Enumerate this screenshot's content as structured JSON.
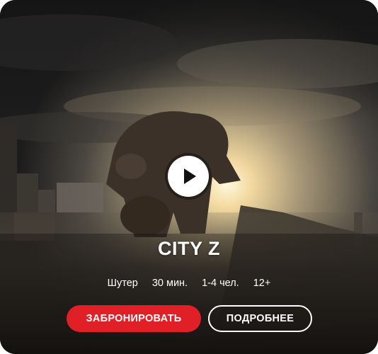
{
  "card": {
    "title": "CITY Z",
    "meta": [
      "Шутер",
      "30 мин.",
      "1-4 чел.",
      "12+"
    ],
    "book_label": "ЗАБРОНИРОВАТЬ",
    "more_label": "ПОДРОБНЕЕ",
    "play_icon": "play-icon"
  },
  "colors": {
    "accent": "#e01f26",
    "text": "#ffffff"
  }
}
